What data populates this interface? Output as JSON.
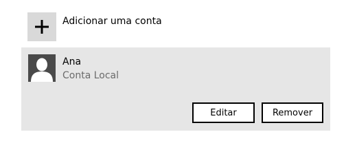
{
  "add_account": {
    "icon": "plus-icon",
    "label": "Adicionar uma conta"
  },
  "account": {
    "avatar_icon": "user-silhouette-icon",
    "name": "Ana",
    "type": "Conta Local",
    "buttons": {
      "edit_label": "Editar",
      "remove_label": "Remover"
    }
  },
  "colors": {
    "panel_background": "#e6e6e6",
    "add_tile_background": "#d9d9d9",
    "avatar_background": "#4a4a4a",
    "secondary_text": "#6b6b6b",
    "button_border": "#000000"
  }
}
